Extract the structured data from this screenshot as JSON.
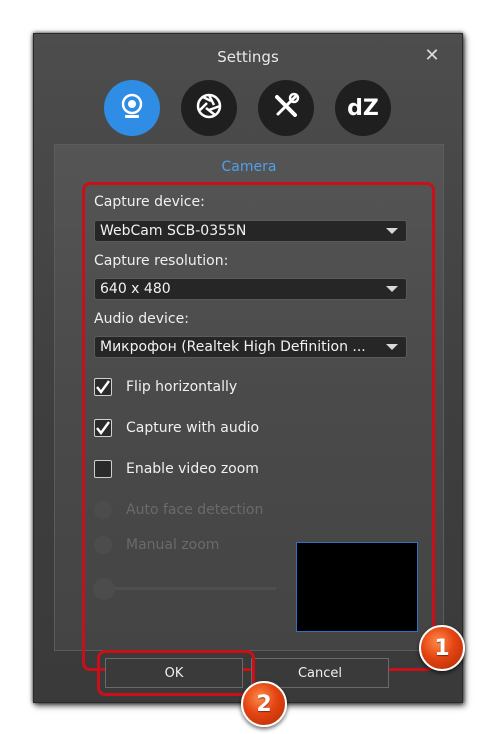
{
  "window": {
    "title": "Settings"
  },
  "tabs": [
    {
      "id": "camera",
      "icon": "webcam-icon",
      "active": true
    },
    {
      "id": "photo",
      "icon": "aperture-icon",
      "active": false
    },
    {
      "id": "tools",
      "icon": "tools-icon",
      "active": false
    },
    {
      "id": "about",
      "label": "dZ",
      "active": false
    }
  ],
  "panel": {
    "title": "Camera"
  },
  "fields": {
    "capture_device_label": "Capture device:",
    "capture_device_value": "WebCam SCB-0355N",
    "capture_resolution_label": "Capture resolution:",
    "capture_resolution_value": "640 x 480",
    "audio_device_label": "Audio device:",
    "audio_device_value": "Микрофон (Realtek High Definition ..."
  },
  "checkboxes": [
    {
      "label": "Flip horizontally",
      "checked": true
    },
    {
      "label": "Capture with audio",
      "checked": true
    },
    {
      "label": "Enable video zoom",
      "checked": false
    }
  ],
  "radios": [
    {
      "label": "Auto face detection",
      "enabled": false
    },
    {
      "label": "Manual zoom",
      "enabled": false
    }
  ],
  "buttons": {
    "ok": "OK",
    "cancel": "Cancel"
  },
  "annotations": {
    "badge1": "1",
    "badge2": "2"
  },
  "colors": {
    "accent": "#2f8de6",
    "highlight": "#c81018",
    "badge": "#e44412"
  }
}
